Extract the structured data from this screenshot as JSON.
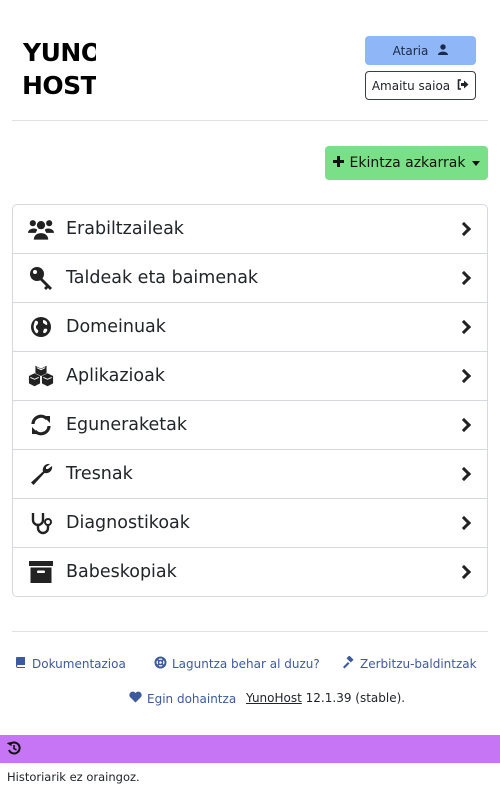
{
  "header": {
    "logo_lines": [
      "YUNO",
      "HOST"
    ],
    "home_label": "Ataria",
    "logout_label": "Amaitu saioa"
  },
  "quick_actions": {
    "label": "Ekintza azkarrak"
  },
  "menu": {
    "items": [
      {
        "label": "Erabiltzaileak",
        "icon": "users-icon"
      },
      {
        "label": "Taldeak eta baimenak",
        "icon": "key-icon"
      },
      {
        "label": "Domeinuak",
        "icon": "globe-icon"
      },
      {
        "label": "Aplikazioak",
        "icon": "cubes-icon"
      },
      {
        "label": "Eguneraketak",
        "icon": "refresh-icon"
      },
      {
        "label": "Tresnak",
        "icon": "wrench-icon"
      },
      {
        "label": "Diagnostikoak",
        "icon": "stethoscope-icon"
      },
      {
        "label": "Babeskopiak",
        "icon": "archive-icon"
      }
    ]
  },
  "footer": {
    "docs_label": "Dokumentazioa",
    "help_label": "Laguntza behar al duzu?",
    "tos_label": "Zerbitzu-baldintzak",
    "donate_label": "Egin dohaintza",
    "brand_link": "YunoHost",
    "version": "12.1.39 (stable)."
  },
  "history": {
    "empty_text": "Historiarik ez oraingoz."
  },
  "colors": {
    "home_button": "#8fb6f6",
    "quick_actions_button": "#7ae087",
    "history_bar": "#c675f5",
    "footer_link": "#3d5a9e"
  }
}
